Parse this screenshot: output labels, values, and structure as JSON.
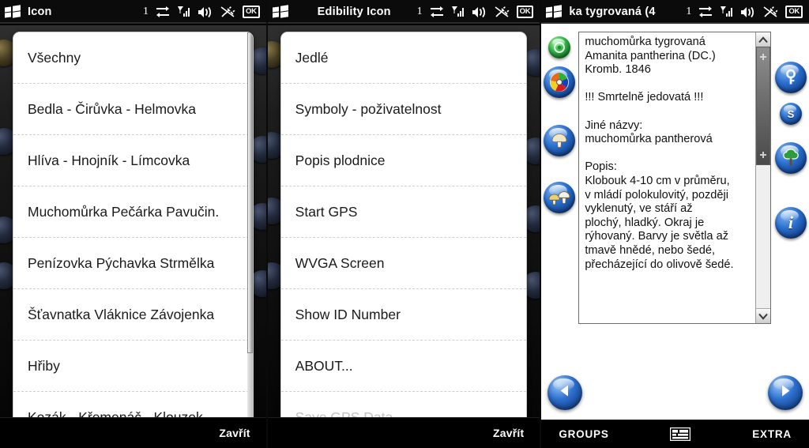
{
  "common": {
    "status_number": "1",
    "ok_label": "OK",
    "close_label": "Zavřít"
  },
  "panel1": {
    "title": "Icon",
    "menu_items": [
      {
        "label": "Všechny",
        "disabled": false
      },
      {
        "label": "Bedla - Čirůvka - Helmovka",
        "disabled": false
      },
      {
        "label": "Hlíva - Hnojník - Límcovka",
        "disabled": false
      },
      {
        "label": "Muchomůrka Pečárka Pavučin.",
        "disabled": false
      },
      {
        "label": "Penízovka Pýchavka Strmělka",
        "disabled": false
      },
      {
        "label": "Šťavnatka Vláknice Závojenka",
        "disabled": false
      },
      {
        "label": "Hřiby",
        "disabled": false
      },
      {
        "label": "Kozák - Křemenáč - Klouzek",
        "disabled": false
      }
    ],
    "softkey": "Zavřít"
  },
  "panel2": {
    "title": "Edibility Icon",
    "menu_items": [
      {
        "label": "Jedlé",
        "disabled": false
      },
      {
        "label": "Symboly - poživatelnost",
        "disabled": false
      },
      {
        "label": "Popis plodnice",
        "disabled": false
      },
      {
        "label": "Start GPS",
        "disabled": false
      },
      {
        "label": "WVGA Screen",
        "disabled": false
      },
      {
        "label": "Show ID Number",
        "disabled": false
      },
      {
        "label": "ABOUT...",
        "disabled": false
      },
      {
        "label": "Save GPS Data",
        "disabled": true
      }
    ],
    "softkey": "Zavřít"
  },
  "panel3": {
    "title": "ka tygrovaná (4",
    "detail_text": "muchomůrka tygrovaná\nAmanita pantherina (DC.)\nKromb. 1846\n\n!!! Smrtelně jedovatá !!!\n\nJiné názvy:\nmuchomůrka pantherová\n\nPopis:\nKlobouk 4-10 cm v průměru,\nv mládí polokulovitý, později\nvyklenutý, ve stáří až\nplochý, hladký. Okraj je\nrýhovaný. Barvy je světla až\ntmavě hnědé, nebo šedé,\npřecházející do olivově šedé.",
    "left_icons": [
      {
        "name": "edibility-green-icon",
        "kind": "green-ring"
      },
      {
        "name": "color-palette-icon",
        "kind": "palette"
      },
      {
        "name": "mushroom-single-icon",
        "kind": "mushroom"
      },
      {
        "name": "mushroom-group-icon",
        "kind": "mushrooms"
      }
    ],
    "right_icons": [
      {
        "name": "key-icon",
        "kind": "key"
      },
      {
        "name": "spores-icon",
        "kind": "letter",
        "text": "S"
      },
      {
        "name": "tree-icon",
        "kind": "tree"
      },
      {
        "name": "info-icon",
        "kind": "letter-i",
        "text": "i"
      }
    ],
    "nav": {
      "prev_name": "previous-button",
      "next_name": "next-button"
    },
    "bottom_bar": {
      "left_label": "GROUPS",
      "center_icon": "keyboard-icon",
      "right_label": "EXTRA"
    }
  }
}
